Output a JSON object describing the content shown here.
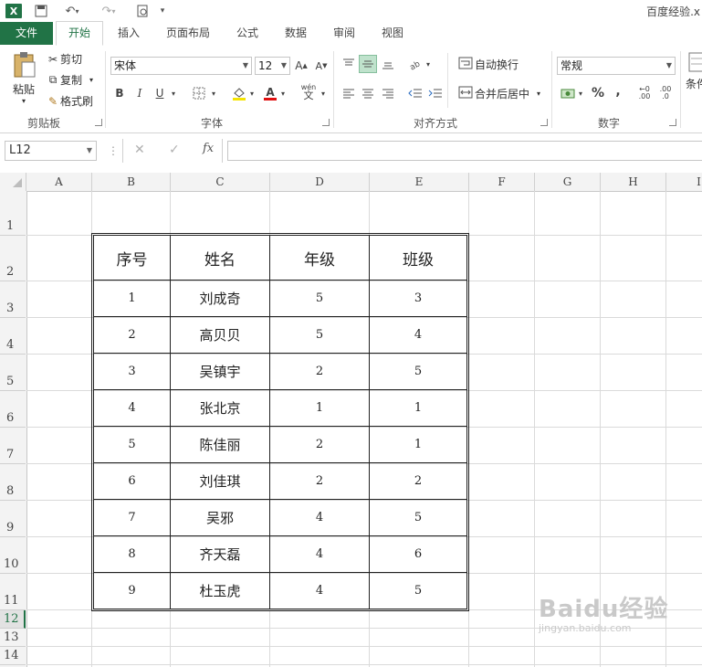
{
  "title": "百度经验.x",
  "tabs": [
    "文件",
    "开始",
    "插入",
    "页面布局",
    "公式",
    "数据",
    "审阅",
    "视图"
  ],
  "clipboard": {
    "paste": "粘贴",
    "cut": "剪切",
    "copy": "复制",
    "format_painter": "格式刷",
    "label": "剪贴板"
  },
  "font": {
    "name": "宋体",
    "size": "12",
    "label": "字体",
    "bold": "B",
    "italic": "I",
    "underline": "U",
    "phonetic": "wén"
  },
  "alignment": {
    "wrap_text": "自动换行",
    "merge_center": "合并后居中",
    "label": "对齐方式"
  },
  "number": {
    "format": "常规",
    "label": "数字",
    "percent": "%",
    "comma": ",",
    "inc_decimal": ".00",
    "dec_decimal": ".0"
  },
  "styles": {
    "conditional": "条件"
  },
  "formula_bar": {
    "name_box": "L12",
    "fx": "fx"
  },
  "columns": [
    "A",
    "B",
    "C",
    "D",
    "E",
    "F",
    "G",
    "H",
    "I"
  ],
  "rows": [
    "1",
    "2",
    "3",
    "4",
    "5",
    "6",
    "7",
    "8",
    "9",
    "10",
    "11",
    "12",
    "13",
    "14"
  ],
  "table": {
    "headers": [
      "序号",
      "姓名",
      "年级",
      "班级"
    ],
    "rows": [
      [
        "1",
        "刘成奇",
        "5",
        "3"
      ],
      [
        "2",
        "高贝贝",
        "5",
        "4"
      ],
      [
        "3",
        "吴镇宇",
        "2",
        "5"
      ],
      [
        "4",
        "张北京",
        "1",
        "1"
      ],
      [
        "5",
        "陈佳丽",
        "2",
        "1"
      ],
      [
        "6",
        "刘佳琪",
        "2",
        "2"
      ],
      [
        "7",
        "吴邪",
        "4",
        "5"
      ],
      [
        "8",
        "齐天磊",
        "4",
        "6"
      ],
      [
        "9",
        "杜玉虎",
        "4",
        "5"
      ]
    ]
  },
  "watermark": {
    "main": "Baidu经验",
    "sub": "jingyan.baidu.com"
  },
  "colors": {
    "accent": "#217346",
    "grid": "#dadada",
    "header_bg": "#f3f3f3"
  }
}
